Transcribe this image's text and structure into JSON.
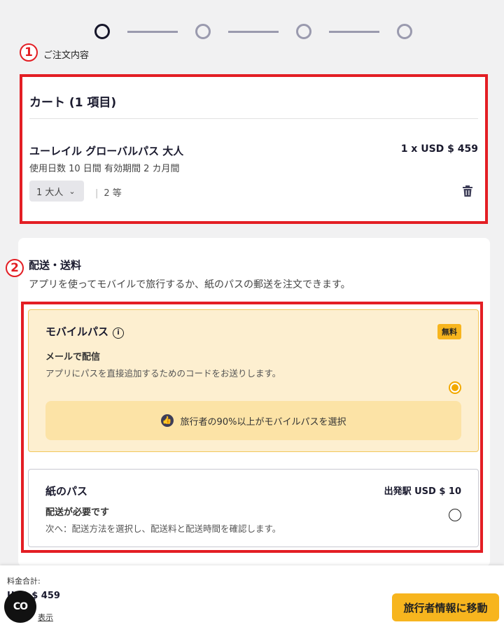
{
  "stepper": {
    "current_step_label": "ご注文内容",
    "badge_1": "1",
    "badge_2": "2"
  },
  "cart": {
    "title": "カート (1 項目)",
    "item": {
      "name": "ユーレイル グローバルパス 大人",
      "price": "1 x USD $ 459",
      "desc": "使用日数 10 日間 有効期間 2 カ月間",
      "qty_value": "1 大人",
      "class": "2 等"
    }
  },
  "shipping": {
    "title": "配送・送料",
    "subtitle": "アプリを使ってモバイルで旅行するか、紙のパスの郵送を注文できます。",
    "mobile": {
      "title": "モバイルパス",
      "badge": "無料",
      "label": "メールで配信",
      "desc": "アプリにパスを直接追加するためのコードをお送りします。",
      "promo": "旅行者の90%以上がモバイルパスを選択",
      "selected": true
    },
    "paper": {
      "title": "紙のパス",
      "price": "出発駅 USD $ 10",
      "label": "配送が必要です",
      "desc": "次へ：配送方法を選択し、配送料と配送時間を確認します。",
      "selected": false
    }
  },
  "footer": {
    "total_label": "料金合計:",
    "total_value": "USD $ 459",
    "detail_link": "表示",
    "fab_label": "CO",
    "next_button": "旅行者情報に移動"
  },
  "colors": {
    "accent": "#f7b51e",
    "highlight_border": "#e31e24",
    "mobile_bg": "#fdefd0"
  }
}
